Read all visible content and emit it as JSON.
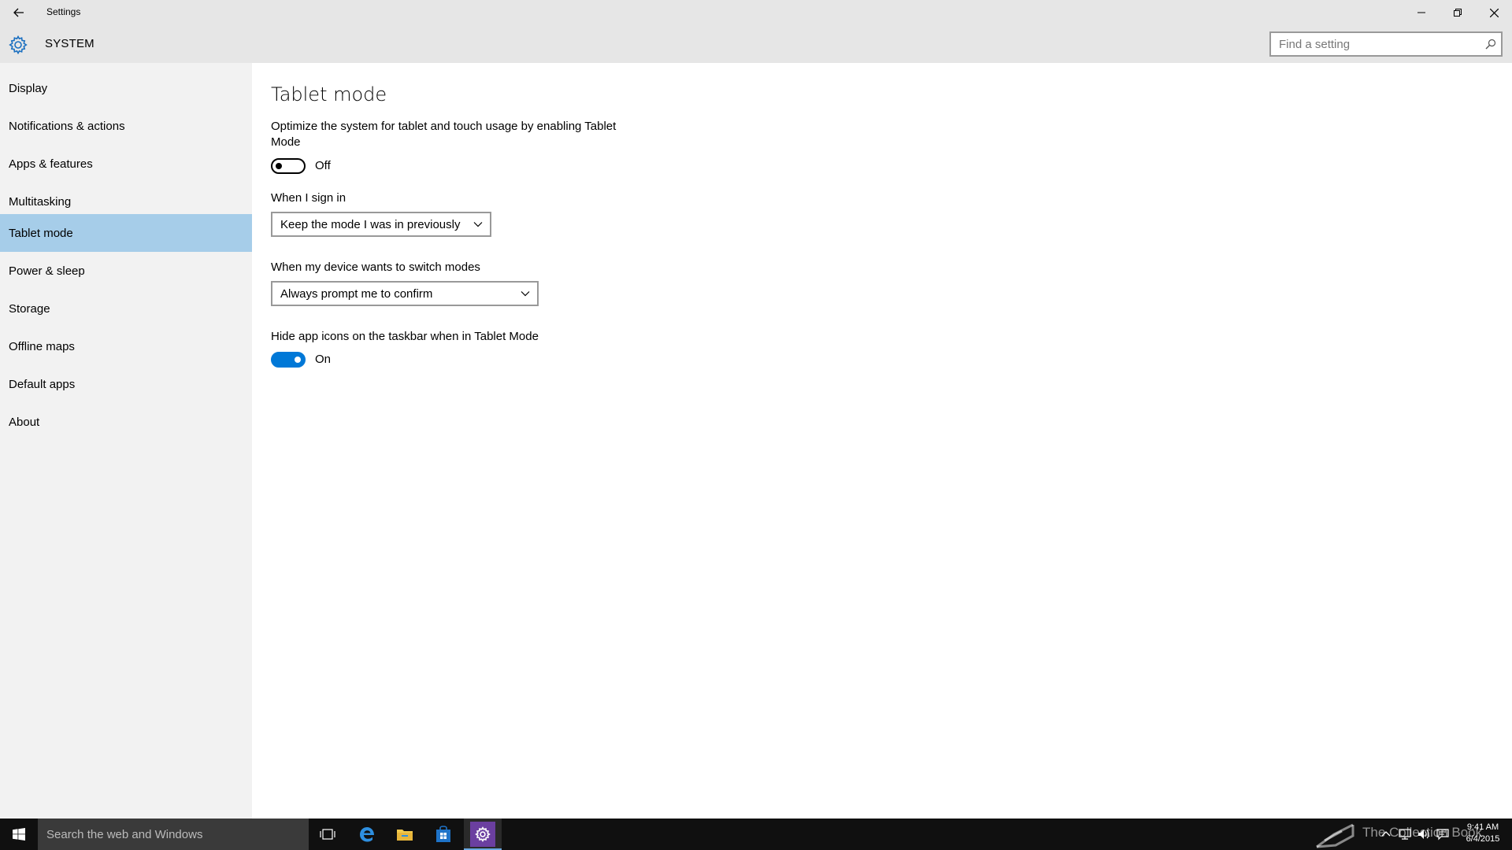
{
  "window": {
    "app_title": "Settings",
    "section_title": "SYSTEM",
    "search_placeholder": "Find a setting"
  },
  "sidebar": {
    "items": [
      {
        "label": "Display",
        "selected": false
      },
      {
        "label": "Notifications & actions",
        "selected": false
      },
      {
        "label": "Apps & features",
        "selected": false
      },
      {
        "label": "Multitasking",
        "selected": false
      },
      {
        "label": "Tablet mode",
        "selected": true
      },
      {
        "label": "Power & sleep",
        "selected": false
      },
      {
        "label": "Storage",
        "selected": false
      },
      {
        "label": "Offline maps",
        "selected": false
      },
      {
        "label": "Default apps",
        "selected": false
      },
      {
        "label": "About",
        "selected": false
      }
    ]
  },
  "main": {
    "title": "Tablet mode",
    "tablet_mode": {
      "description": "Optimize the system for tablet and touch usage by enabling Tablet Mode",
      "state": "Off"
    },
    "sign_in": {
      "label": "When I sign in",
      "selected": "Keep the mode I was in previously"
    },
    "switch_modes": {
      "label": "When my device wants to switch modes",
      "selected": "Always prompt me to confirm"
    },
    "hide_icons": {
      "label": "Hide app icons on the taskbar when in Tablet Mode",
      "state": "On"
    }
  },
  "taskbar": {
    "search_placeholder": "Search the web and Windows",
    "time": "9:41 AM",
    "date": "6/4/2015",
    "watermark": "The Collection Book"
  },
  "colors": {
    "accent": "#0078d7",
    "selected_nav": "#a6cde9",
    "titlebar": "#e6e6e6",
    "sidebar": "#f2f2f2",
    "taskbar": "#101010"
  },
  "icons": {
    "titlebar": [
      "back-arrow-icon",
      "minimize-icon",
      "restore-icon",
      "close-icon",
      "gear-icon",
      "search-icon"
    ],
    "taskbar": [
      "windows-logo-icon",
      "task-view-icon",
      "edge-icon",
      "file-explorer-icon",
      "store-icon",
      "settings-gear-icon",
      "chevron-up-icon",
      "network-icon",
      "volume-icon",
      "action-center-icon",
      "book-icon"
    ]
  }
}
